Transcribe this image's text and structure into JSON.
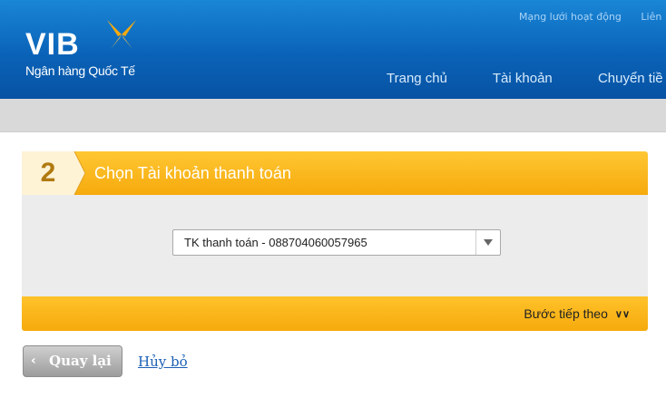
{
  "brand": {
    "name": "VIB",
    "tagline": "Ngân hàng Quốc Tế",
    "logo_icon": "vib-bird-icon"
  },
  "top_links": [
    "Mạng lưới hoạt động",
    "Liên"
  ],
  "nav": [
    "Trang chủ",
    "Tài khoản",
    "Chuyển tiề"
  ],
  "step": {
    "number": "2",
    "title": "Chọn Tài khoản thanh toán"
  },
  "account_select": {
    "selected": "TK thanh toán - 088704060057965"
  },
  "next_step": {
    "label": "Bước tiếp theo",
    "icon": "double-chevron-down-icon"
  },
  "actions": {
    "back": "Quay lại",
    "cancel": "Hủy bỏ"
  },
  "colors": {
    "header_blue": "#0a63b8",
    "accent_yellow": "#f6aa0c",
    "link_blue": "#1a5fb4"
  }
}
